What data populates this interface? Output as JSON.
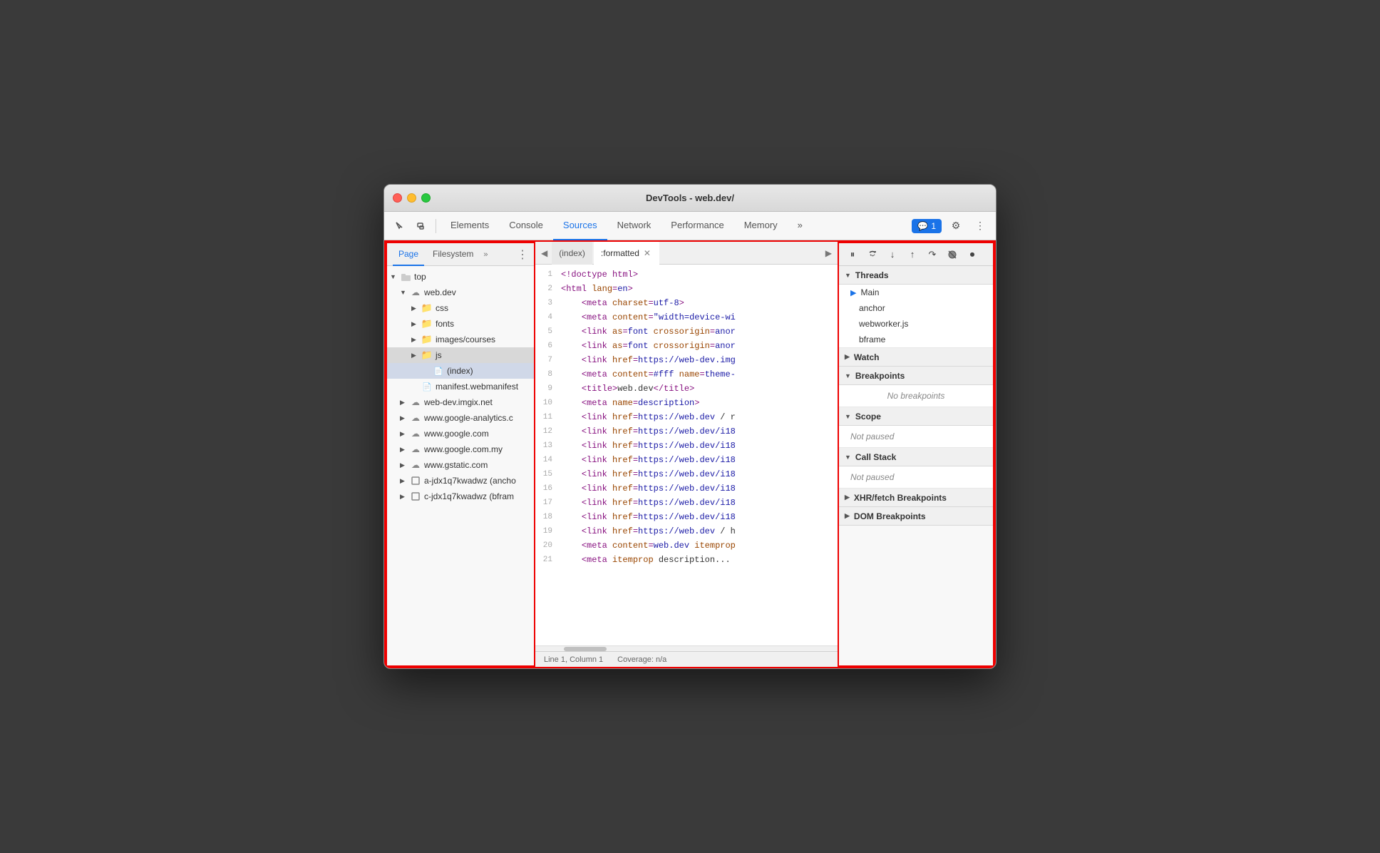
{
  "window": {
    "title": "DevTools - web.dev/"
  },
  "toolbar": {
    "tabs": [
      "Elements",
      "Console",
      "Sources",
      "Network",
      "Performance",
      "Memory"
    ],
    "active_tab": "Sources",
    "more_tabs": "»",
    "notification_label": "1",
    "settings_icon": "⚙",
    "more_icon": "⋮"
  },
  "left_panel": {
    "tabs": [
      "Page",
      "Filesystem"
    ],
    "more": "»",
    "menu": "⋮",
    "active_tab": "Page",
    "tree": [
      {
        "label": "top",
        "type": "root",
        "level": 0,
        "expanded": true
      },
      {
        "label": "web.dev",
        "type": "cloud",
        "level": 1,
        "expanded": true
      },
      {
        "label": "css",
        "type": "folder",
        "level": 2,
        "expanded": false
      },
      {
        "label": "fonts",
        "type": "folder",
        "level": 2,
        "expanded": false
      },
      {
        "label": "images/courses",
        "type": "folder",
        "level": 2,
        "expanded": false
      },
      {
        "label": "js",
        "type": "folder",
        "level": 2,
        "expanded": false
      },
      {
        "label": "(index)",
        "type": "file",
        "level": 3,
        "selected": true
      },
      {
        "label": "manifest.webmanifest",
        "type": "file",
        "level": 2
      },
      {
        "label": "web-dev.imgix.net",
        "type": "cloud",
        "level": 1,
        "expanded": false
      },
      {
        "label": "www.google-analytics.c",
        "type": "cloud",
        "level": 1,
        "expanded": false
      },
      {
        "label": "www.google.com",
        "type": "cloud",
        "level": 1,
        "expanded": false
      },
      {
        "label": "www.google.com.my",
        "type": "cloud",
        "level": 1,
        "expanded": false
      },
      {
        "label": "www.gstatic.com",
        "type": "cloud",
        "level": 1,
        "expanded": false
      },
      {
        "label": "a-jdx1q7kwadwz (ancho",
        "type": "frame",
        "level": 1,
        "expanded": false
      },
      {
        "label": "c-jdx1q7kwadwz (bfram",
        "type": "frame",
        "level": 1,
        "expanded": false
      }
    ]
  },
  "editor": {
    "tabs": [
      {
        "label": "(index)",
        "active": false
      },
      {
        "label": ":formatted",
        "active": true,
        "closable": true
      }
    ],
    "lines": [
      {
        "num": 1,
        "content": "<!doctype html>"
      },
      {
        "num": 2,
        "content": "<html lang=en>"
      },
      {
        "num": 3,
        "content": "    <meta charset=utf-8>"
      },
      {
        "num": 4,
        "content": "    <meta content=\"width=device-wi"
      },
      {
        "num": 5,
        "content": "    <link as=font crossorigin=anor"
      },
      {
        "num": 6,
        "content": "    <link as=font crossorigin=anor"
      },
      {
        "num": 7,
        "content": "    <link href=https://web-dev.img"
      },
      {
        "num": 8,
        "content": "    <meta content=#fff name=theme-"
      },
      {
        "num": 9,
        "content": "    <title>web.dev</title>"
      },
      {
        "num": 10,
        "content": "    <meta name=description>"
      },
      {
        "num": 11,
        "content": "    <link href=https://web.dev / r"
      },
      {
        "num": 12,
        "content": "    <link href=https://web.dev/i18"
      },
      {
        "num": 13,
        "content": "    <link href=https://web.dev/i18"
      },
      {
        "num": 14,
        "content": "    <link href=https://web.dev/i18"
      },
      {
        "num": 15,
        "content": "    <link href=https://web.dev/i18"
      },
      {
        "num": 16,
        "content": "    <link href=https://web.dev/i18"
      },
      {
        "num": 17,
        "content": "    <link href=https://web.dev/i18"
      },
      {
        "num": 18,
        "content": "    <link href=https://web.dev/i18"
      },
      {
        "num": 19,
        "content": "    <link href=https://web.dev / h"
      },
      {
        "num": 20,
        "content": "    <meta content=web.dev itemprop"
      },
      {
        "num": 21,
        "content": "    <meta itemprop description..."
      }
    ],
    "statusbar": {
      "position": "Line 1, Column 1",
      "coverage": "Coverage: n/a"
    }
  },
  "right_panel": {
    "debug_buttons": [
      "⏸",
      "↺",
      "↓",
      "↑",
      "↷",
      "✎",
      "⏺"
    ],
    "sections": {
      "threads": {
        "label": "Threads",
        "items": [
          "Main",
          "anchor",
          "webworker.js",
          "bframe"
        ]
      },
      "watch": {
        "label": "Watch"
      },
      "breakpoints": {
        "label": "Breakpoints",
        "empty_text": "No breakpoints"
      },
      "scope": {
        "label": "Scope",
        "empty_text": "Not paused"
      },
      "call_stack": {
        "label": "Call Stack",
        "empty_text": "Not paused"
      },
      "xhr_breakpoints": {
        "label": "XHR/fetch Breakpoints"
      },
      "dom_breakpoints": {
        "label": "DOM Breakpoints"
      }
    }
  }
}
